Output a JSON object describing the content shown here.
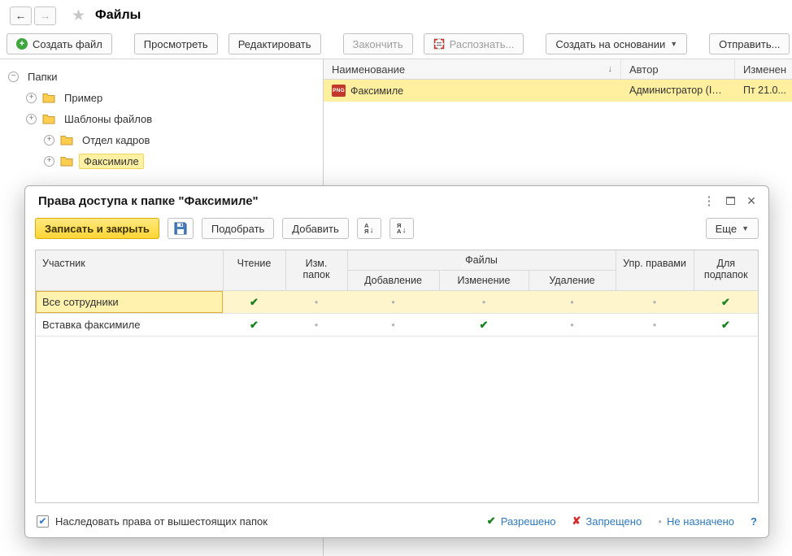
{
  "titlebar": {
    "title": "Файлы"
  },
  "toolbar": {
    "create_file": "Создать файл",
    "view": "Просмотреть",
    "edit": "Редактировать",
    "finish": "Закончить",
    "recognize": "Распознать...",
    "create_based_on": "Создать на основании",
    "send": "Отправить..."
  },
  "tree": {
    "root": "Папки",
    "items": [
      {
        "label": "Пример"
      },
      {
        "label": "Шаблоны файлов"
      },
      {
        "label": "Отдел кадров"
      },
      {
        "label": "Факсимиле"
      }
    ]
  },
  "file_list": {
    "columns": {
      "name": "Наименование",
      "author": "Автор",
      "modified": "Изменен"
    },
    "rows": [
      {
        "name": "Факсимиле",
        "type": "PNG",
        "author": "Администратор (IT - кл...",
        "modified": "Пт 21.0..."
      }
    ]
  },
  "dialog": {
    "title": "Права доступа к папке \"Факсимиле\"",
    "toolbar": {
      "save_and_close": "Записать и закрыть",
      "pick": "Подобрать",
      "add": "Добавить",
      "more": "Еще"
    },
    "table": {
      "headers": {
        "participant": "Участник",
        "read": "Чтение",
        "folder_edit": "Изм. папок",
        "files": "Файлы",
        "add": "Добавление",
        "edit": "Изменение",
        "remove": "Удаление",
        "manage": "Упр. правами",
        "subfolders": "Для подпапок"
      },
      "rows": [
        {
          "participant": "Все сотрудники",
          "read": "allowed",
          "folder_edit": "none",
          "add": "none",
          "edit": "none",
          "remove": "none",
          "manage": "none",
          "subfolders": "allowed"
        },
        {
          "participant": "Вставка факсимиле",
          "read": "allowed",
          "folder_edit": "none",
          "add": "none",
          "edit": "allowed",
          "remove": "none",
          "manage": "none",
          "subfolders": "allowed"
        }
      ]
    },
    "footer": {
      "inherit": "Наследовать права от вышестоящих папок",
      "allowed": "Разрешено",
      "denied": "Запрещено",
      "not_assigned": "Не назначено",
      "help": "?"
    }
  }
}
